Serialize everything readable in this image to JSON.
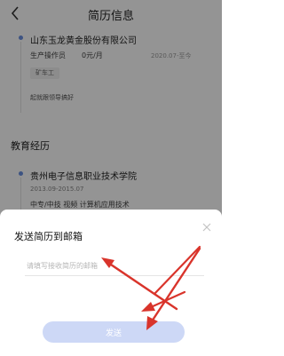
{
  "header": {
    "title": "简历信息",
    "back_icon": "chevron-left-icon"
  },
  "work": {
    "company": "山东玉龙黄金股份有限公司",
    "position": "生产操作员",
    "salary": "0元/月",
    "date": "2020.07-至今",
    "tag": "矿车工",
    "description": "起就跟领导搞好"
  },
  "education": {
    "section_title": "教育经历",
    "school": "贵州电子信息职业技术学院",
    "date": "2013.09-2015.07",
    "detail": "中专/中技   视频   计算机应用技术"
  },
  "dialog": {
    "title": "发送简历到邮箱",
    "close_icon": "close-icon",
    "email_placeholder": "请填写接收简历的邮箱",
    "send_label": "发送"
  },
  "colors": {
    "accent": "#6a8fe0",
    "send_button_bg": "#cdd8f6",
    "annotation_arrow": "#d9342b"
  }
}
